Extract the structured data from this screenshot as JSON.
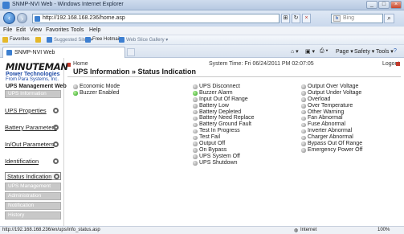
{
  "window": {
    "title": "SNMP-NVI Web - Windows Internet Explorer",
    "minimize": "_",
    "maximize": "□",
    "close": "×"
  },
  "navigation": {
    "address": "http://192.168.168.236/home.asp",
    "search_placeholder": "Bing"
  },
  "menu": [
    "File",
    "Edit",
    "View",
    "Favorites",
    "Tools",
    "Help"
  ],
  "favorites": {
    "label": "Favorites",
    "items": [
      "Suggested Sites ▾",
      "Free Hotmail",
      "Web Slice Gallery ▾"
    ]
  },
  "tab": {
    "title": "SNMP-NVI Web"
  },
  "commands": {
    "page": "Page ▾",
    "safety": "Safety ▾",
    "tools": "Tools ▾",
    "help": "?"
  },
  "sidebar": {
    "logo_main": "MINUTEMAN",
    "logo_sub": "Power Technologies",
    "logo_tag": "From Para Systems, Inc.",
    "section_title": "UPS Management Web",
    "ups_information": "UPS Information",
    "links": [
      "UPS Properties",
      "Battery Parameters",
      "In/Out Parameters",
      "Identification"
    ],
    "selected": "Status Indication",
    "bottom_buttons": [
      "UPS Management",
      "Administration",
      "Notification",
      "History"
    ]
  },
  "header": {
    "home": "Home",
    "title": "UPS Information » Status Indication",
    "system_time": "System Time: Fri 06/24/2011 PM 02:07:05",
    "logout": "Logout"
  },
  "indicators": {
    "col1": [
      {
        "label": "Economic Mode",
        "state": "off"
      },
      {
        "label": "Buzzer Enabled",
        "state": "on"
      }
    ],
    "col2": [
      {
        "label": "UPS Disconnect",
        "state": "off"
      },
      {
        "label": "Buzzer Alarm",
        "state": "on"
      },
      {
        "label": "Input Out Of Range",
        "state": "off"
      },
      {
        "label": "Battery Low",
        "state": "off"
      },
      {
        "label": "Battery Depleted",
        "state": "off"
      },
      {
        "label": "Battery Need Replace",
        "state": "off"
      },
      {
        "label": "Battery Ground Fault",
        "state": "off"
      },
      {
        "label": "Test In Progress",
        "state": "off"
      },
      {
        "label": "Test Fail",
        "state": "off"
      },
      {
        "label": "Output Off",
        "state": "off"
      },
      {
        "label": "On Bypass",
        "state": "off"
      },
      {
        "label": "UPS System Off",
        "state": "off"
      },
      {
        "label": "UPS Shutdown",
        "state": "off"
      }
    ],
    "col3": [
      {
        "label": "Output Over Voltage",
        "state": "off"
      },
      {
        "label": "Output Under Voltage",
        "state": "off"
      },
      {
        "label": "Overload",
        "state": "off"
      },
      {
        "label": "Over Temperature",
        "state": "off"
      },
      {
        "label": "Other Warning",
        "state": "off"
      },
      {
        "label": "Fan Abnormal",
        "state": "off"
      },
      {
        "label": "Fuse Abnormal",
        "state": "off"
      },
      {
        "label": "Inverter Abnormal",
        "state": "off"
      },
      {
        "label": "Charger Abnormal",
        "state": "off"
      },
      {
        "label": "Bypass Out Of Range",
        "state": "off"
      },
      {
        "label": "Emergency Power Off",
        "state": "off"
      }
    ]
  },
  "status_bar": {
    "url": "http://192.168.168.236/en/ups/info_status.asp",
    "zone": "Internet",
    "zoom": "100%"
  },
  "colors": {
    "on": "#2b9e1c",
    "off": "#8a8a8a",
    "brand": "#1e4aa5"
  }
}
